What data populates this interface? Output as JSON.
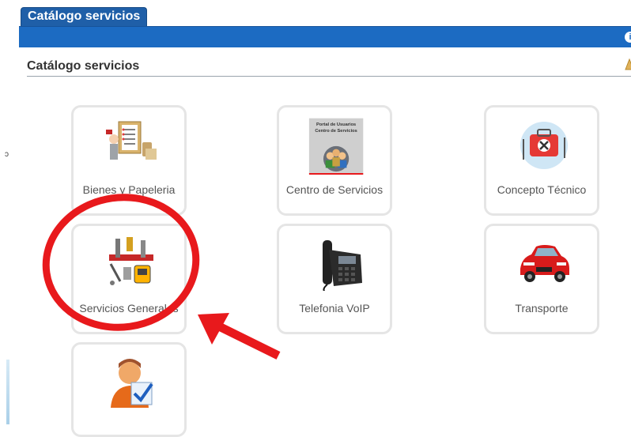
{
  "tab": {
    "label": "Catálogo servicios"
  },
  "header": {
    "title": "Catálogo servicios"
  },
  "rail": {
    "mark": "ɔ"
  },
  "cards": [
    {
      "label": "Bienes y Papeleria",
      "icon": "clipboard-stationery-icon"
    },
    {
      "label": "Centro de Servicios",
      "icon": "portal-users-icon",
      "image_text": [
        "Portal de Usuarios",
        "Centro de Servicios"
      ]
    },
    {
      "label": "Concepto Técnico",
      "icon": "toolbox-icon"
    },
    {
      "label": "Servicios Generales",
      "icon": "tools-icon"
    },
    {
      "label": "Telefonia VoIP",
      "icon": "desk-phone-icon"
    },
    {
      "label": "Transporte",
      "icon": "car-icon"
    },
    {
      "label": "",
      "icon": "user-check-icon"
    }
  ],
  "colors": {
    "tab": "#1f5fa8",
    "bar": "#1c6bc2",
    "annotation": "#e8191c"
  }
}
